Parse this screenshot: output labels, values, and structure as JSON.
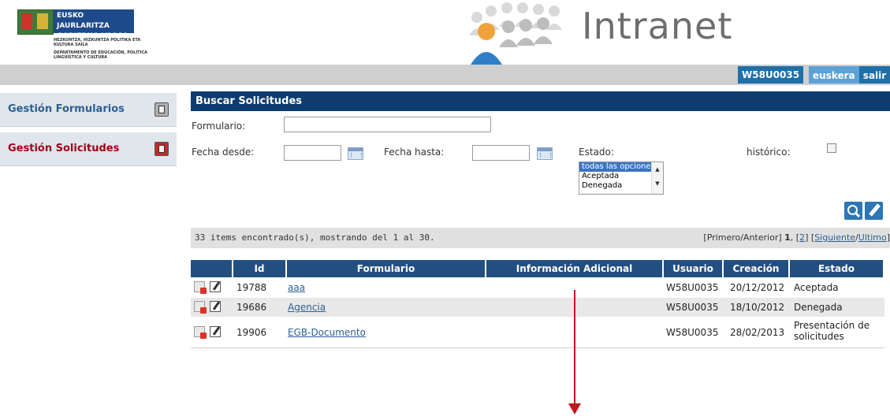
{
  "header": {
    "logo": {
      "line1": "EUSKO JAURLARITZA",
      "line2": "GOBIERNO VASCO",
      "dept1": "HEZKUNTZA, HIZKUNTZA POLITIKA ETA KULTURA SAILA",
      "dept2": "DEPARTAMENTO DE EDUCACIÓN, POLÍTICA LINGÜÍSTICA Y CULTURA"
    },
    "app_title": "Intranet",
    "user_id": "W58U0035",
    "language_link": "euskera",
    "logout_link": "salir"
  },
  "sidebar": {
    "items": [
      {
        "label": "Gestión Formularios",
        "icon": "form-icon",
        "active": false,
        "color": "#2c5f93"
      },
      {
        "label": "Gestión Solicitudes",
        "icon": "form-icon",
        "active": true,
        "color": "#a0001a"
      }
    ]
  },
  "search": {
    "title": "Buscar Solicitudes",
    "form_label": "Formulario:",
    "form_value": "",
    "date_from_label": "Fecha desde:",
    "date_from_value": "",
    "date_to_label": "Fecha hasta:",
    "date_to_value": "",
    "status_label": "Estado:",
    "status_options": [
      "todas las opciones",
      "Aceptada",
      "Denegada"
    ],
    "status_selected": "todas las opciones",
    "history_label": "histórico:",
    "history_checked": false
  },
  "results": {
    "summary": "33 items encontrado(s), mostrando del 1 al 30.",
    "pager": {
      "first_prev": "[Primero/Anterior]",
      "page1": "1",
      "page2": "2",
      "next": "Siguiente",
      "last": "Ultimo"
    }
  },
  "table": {
    "columns": [
      "Id",
      "Formulario",
      "Información Adicional",
      "Usuario",
      "Creación",
      "Estado"
    ],
    "rows": [
      {
        "id": "19788",
        "form": "aaa",
        "info": "",
        "user": "W58U0035",
        "created": "20/12/2012",
        "status": "Aceptada"
      },
      {
        "id": "19686",
        "form": "Agencia",
        "info": "",
        "user": "W58U0035",
        "created": "18/10/2012",
        "status": "Denegada"
      },
      {
        "id": "19906",
        "form": "EGB-Documento",
        "info": "",
        "user": "W58U0035",
        "created": "28/02/2013",
        "status_l1": "Presentación de",
        "status_l2": "solicitudes"
      }
    ]
  },
  "colors": {
    "accent": "#0e3c6e",
    "link": "#2c5f93",
    "annotation_arrow": "#c0161c"
  }
}
